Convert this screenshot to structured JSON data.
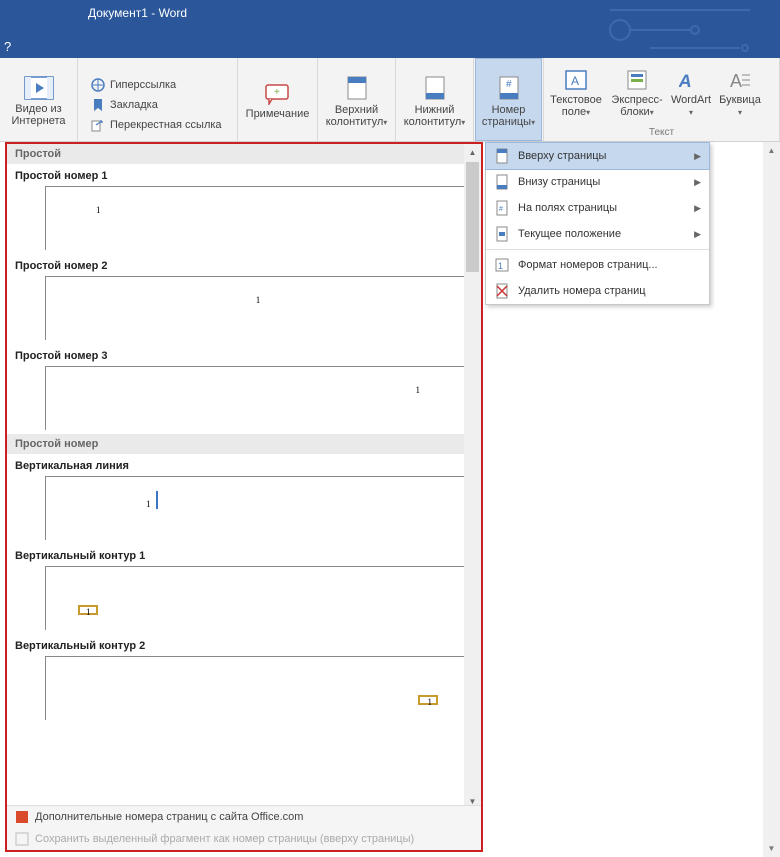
{
  "title": "Документ1 - Word",
  "question_mark": "?",
  "ribbon": {
    "video": {
      "line1": "Видео из",
      "line2": "Интернета"
    },
    "links": {
      "hyperlink": "Гиперссылка",
      "bookmark": "Закладка",
      "crossref": "Перекрестная ссылка"
    },
    "comment": "Примечание",
    "header": {
      "line1": "Верхний",
      "line2": "колонтитул"
    },
    "footer": {
      "line1": "Нижний",
      "line2": "колонтитул"
    },
    "pagenum": {
      "line1": "Номер",
      "line2": "страницы"
    },
    "textbox": {
      "line1": "Текстовое",
      "line2": "поле"
    },
    "quick": {
      "line1": "Экспресс-",
      "line2": "блоки"
    },
    "wordart": "WordArt",
    "dropcap": "Буквица",
    "group_text": "Текст"
  },
  "menu": {
    "top": "Вверху страницы",
    "bottom": "Внизу страницы",
    "margins": "На полях страницы",
    "current": "Текущее положение",
    "format": "Формат номеров страниц...",
    "remove": "Удалить номера страниц"
  },
  "gallery": {
    "h1": "Простой",
    "i1": "Простой номер 1",
    "i2": "Простой номер 2",
    "i3": "Простой номер 3",
    "h2": "Простой номер",
    "i4": "Вертикальная линия",
    "i5": "Вертикальный контур 1",
    "i6": "Вертикальный контур 2",
    "num": "1",
    "foot_more": "Дополнительные номера страниц с сайта Office.com",
    "foot_save": "Сохранить выделенный фрагмент как номер страницы (вверху страницы)"
  }
}
